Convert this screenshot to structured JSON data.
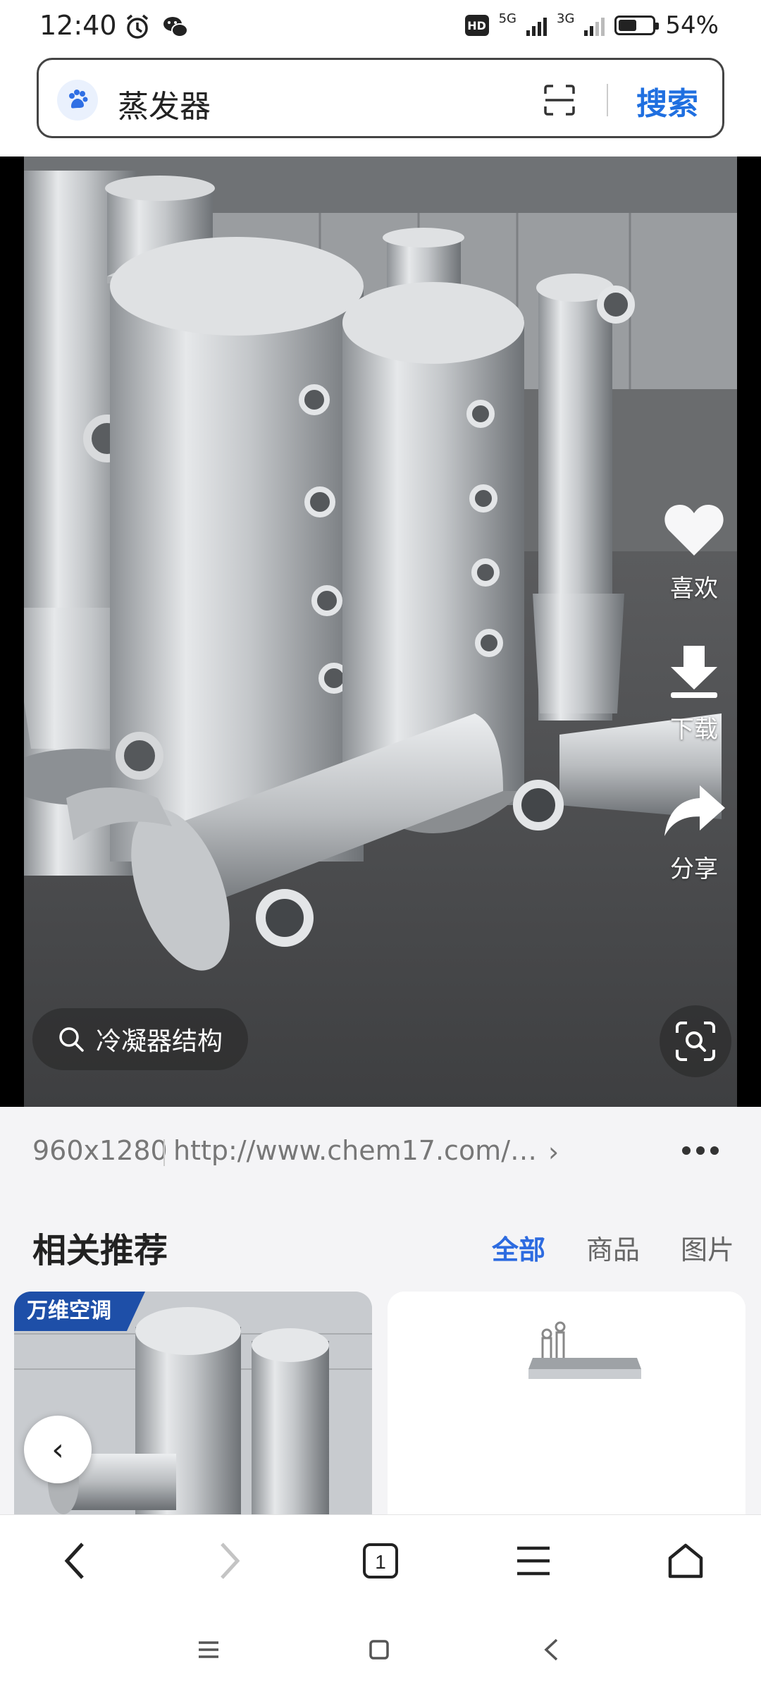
{
  "status_bar": {
    "time": "12:40",
    "hd": "HD",
    "network_1": "5G",
    "network_2": "3G",
    "battery_level": 0.54,
    "battery_text": "54%"
  },
  "search": {
    "query": "蒸发器",
    "button_label": "搜索"
  },
  "viewer": {
    "actions": {
      "like": "喜欢",
      "download": "下载",
      "share": "分享"
    },
    "related_chip": "冷凝器结构"
  },
  "image_info": {
    "dimensions": "960x1280",
    "source_url": "http://www.chem17.com/Pr…"
  },
  "related": {
    "title": "相关推荐",
    "tabs": [
      "全部",
      "商品",
      "图片"
    ],
    "active_tab": "全部",
    "cards": [
      {
        "tag": "万维空调"
      },
      {
        "tag": ""
      }
    ]
  },
  "colors": {
    "accent": "#2d6be0",
    "search_button": "#1f6fe0",
    "brand_tag": "#1e4fa8"
  },
  "icons": {
    "paw": "baidu-paw-icon",
    "scan": "scan-icon",
    "like": "heart-icon",
    "download": "download-icon",
    "share": "share-arrow-icon",
    "search_small": "search-icon",
    "visual_search": "visual-search-icon"
  }
}
